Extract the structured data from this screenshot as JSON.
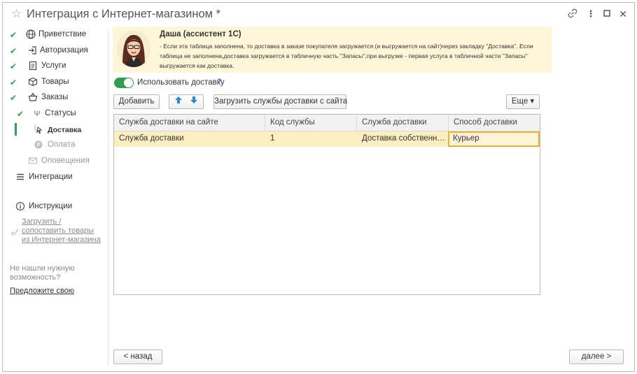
{
  "window": {
    "title": "Интеграция с Интернет-магазином *"
  },
  "sidebar": {
    "items": [
      {
        "label": "Приветствие",
        "icon": "globe-icon"
      },
      {
        "label": "Авторизация",
        "icon": "login-icon"
      },
      {
        "label": "Услуги",
        "icon": "document-icon"
      },
      {
        "label": "Товары",
        "icon": "box-icon"
      },
      {
        "label": "Заказы",
        "icon": "basket-icon"
      },
      {
        "label": "Статусы",
        "icon": "fork-icon"
      },
      {
        "label": "Доставка",
        "icon": "delivery-icon"
      },
      {
        "label": "Оплата",
        "icon": "payment-icon"
      },
      {
        "label": "Оповещения",
        "icon": "envelope-icon"
      },
      {
        "label": "Интеграции",
        "icon": "menu-icon"
      },
      {
        "label": "Инструкции",
        "icon": "info-icon"
      }
    ],
    "load_link": "Загрузить / сопоставить товары из Интернет-магазина",
    "not_found_text": "Не нашли нужную возможность?",
    "suggest_link": "Предложите свою"
  },
  "assistant": {
    "name": "Даша (ассистент 1С)",
    "text": "- Если эта таблица заполнена, то доставка в заказе покупателя загружается (и выгружается на сайт)через закладку \"Доставка\". Если таблица не заполнена,доставка загружается в табличную часть \"Запасы\",при выгрузке - первая услуга в табличной части \"Запасы\" выгружается как доставка."
  },
  "settings": {
    "use_delivery_label": "Использовать доставку",
    "use_delivery_checked": true,
    "help_mark": "?"
  },
  "toolbar": {
    "add_label": "Добавить",
    "load_services_label": "Загрузить службы доставки с сайта",
    "more_label": "Еще ▾"
  },
  "table": {
    "columns": [
      "Служба доставки на сайте",
      "Код службы",
      "Служба доставки",
      "Способ доставки"
    ],
    "rows": [
      [
        "Служба доставки",
        "1",
        "Доставка собственными силами",
        "Курьер"
      ]
    ]
  },
  "footer": {
    "back_label": "< назад",
    "next_label": "далее >"
  },
  "colors": {
    "accent_green": "#2e9e4f",
    "banner_bg": "#fdf6d8",
    "row_highlight": "#fbeec1",
    "link_blue": "#3a7bd5"
  }
}
